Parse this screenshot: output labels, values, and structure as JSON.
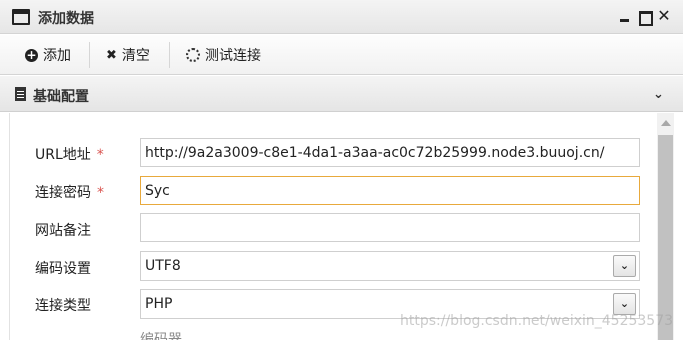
{
  "window": {
    "title": "添加数据",
    "controls": {
      "minimize": "_",
      "maximize": "□",
      "close": "✕"
    }
  },
  "toolbar": {
    "add_label": "添加",
    "clear_label": "清空",
    "test_label": "测试连接"
  },
  "section": {
    "title": "基础配置"
  },
  "form": {
    "url": {
      "label": "URL地址",
      "required": "*",
      "value": "http://9a2a3009-c8e1-4da1-a3aa-ac0c72b25999.node3.buuoj.cn/"
    },
    "password": {
      "label": "连接密码",
      "required": "*",
      "value": "Syc"
    },
    "note": {
      "label": "网站备注",
      "value": ""
    },
    "encoding": {
      "label": "编码设置",
      "selected": "UTF8"
    },
    "conn_type": {
      "label": "连接类型",
      "selected": "PHP"
    },
    "next_partial": "编码器"
  },
  "watermark": "https://blog.csdn.net/weixin_45253573",
  "icons": {
    "window": "window-icon",
    "add": "plus-circle-icon",
    "clear": "x-icon",
    "test": "spinner-icon",
    "section": "document-icon",
    "collapse": "chevron-down-icon"
  },
  "colors": {
    "focus_border": "#e8a93c",
    "required": "#d9534f"
  }
}
